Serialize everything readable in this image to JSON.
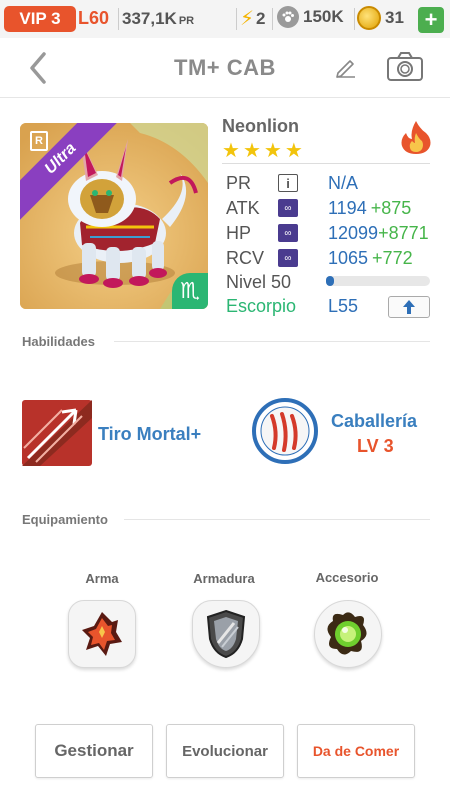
{
  "statusbar": {
    "vip": "VIP 3",
    "level": "L60",
    "power": "337,1K",
    "power_unit": "PR",
    "energy": "2",
    "food": "150K",
    "coins": "31",
    "add": "+"
  },
  "header": {
    "title": "TM+ CAB"
  },
  "monster": {
    "rarity": "Ultra",
    "rank": "R",
    "name": "Neonlion",
    "stars": 4,
    "element": "fire",
    "stats": {
      "pr": {
        "label": "PR",
        "value": "N/A"
      },
      "atk": {
        "label": "ATK",
        "value": "1194",
        "bonus": "+875"
      },
      "hp": {
        "label": "HP",
        "value": "12099",
        "bonus": "+8771"
      },
      "rcv": {
        "label": "RCV",
        "value": "1065",
        "bonus": "+772"
      }
    },
    "level_label": "Nivel 50",
    "level_progress": 0.08,
    "zodiac": "Escorpio",
    "zodiac_symbol": "♏",
    "level_cap": "L55"
  },
  "skills": {
    "header": "Habilidades",
    "active": {
      "name": "Tiro Mortal+"
    },
    "passive": {
      "name": "Caballería",
      "level": "LV 3"
    }
  },
  "equipment": {
    "header": "Equipamiento",
    "weapon": "Arma",
    "armor": "Armadura",
    "accessory": "Accesorio"
  },
  "actions": {
    "manage": "Gestionar",
    "evolve": "Evolucionar",
    "feed": "Da de Comer"
  },
  "colors": {
    "accent_orange": "#e8542c",
    "stat_blue": "#2e6fb7",
    "bonus_green": "#46b54a",
    "zodiac_green": "#2bb673",
    "ultra_purple": "#8a3fc0",
    "star_gold": "#f2c40c"
  }
}
